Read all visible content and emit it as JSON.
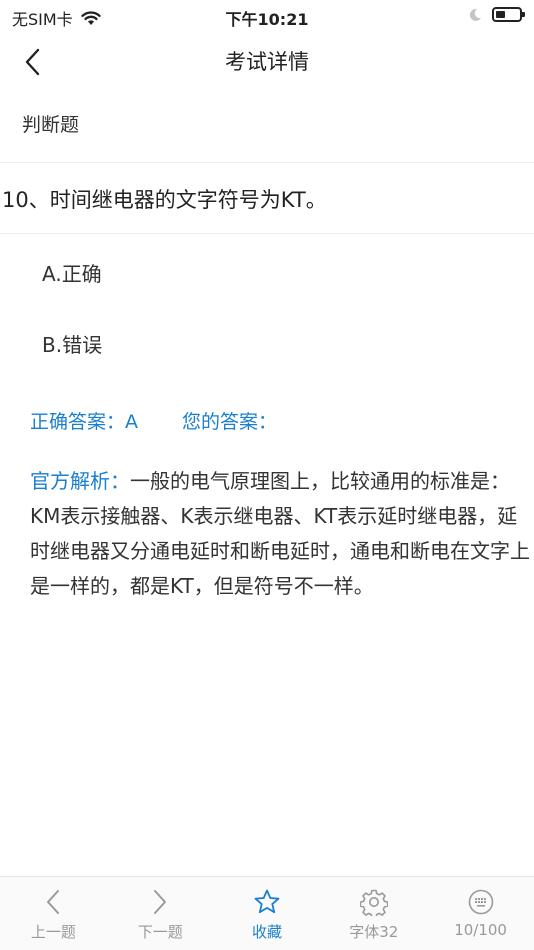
{
  "status_bar": {
    "carrier": "无SIM卡",
    "time": "下午10:21"
  },
  "nav": {
    "title": "考试详情"
  },
  "section": {
    "type_label": "判断题"
  },
  "question": {
    "text": "10、时间继电器的文字符号为KT。"
  },
  "options": [
    {
      "label": "A.正确"
    },
    {
      "label": "B.错误"
    }
  ],
  "answers": {
    "correct": "正确答案：A",
    "yours": "您的答案："
  },
  "analysis": {
    "label": "官方解析：",
    "text": "一般的电气原理图上，比较通用的标准是：KM表示接触器、K表示继电器、KT表示延时继电器，延时继电器又分通电延时和断电延时，通电和断电在文字上是一样的，都是KT，但是符号不一样。"
  },
  "tabs": [
    {
      "label": "上一题",
      "icon": "chevron-left-icon"
    },
    {
      "label": "下一题",
      "icon": "chevron-right-icon"
    },
    {
      "label": "收藏",
      "icon": "star-icon"
    },
    {
      "label": "字体32",
      "icon": "gear-icon"
    },
    {
      "label": "10/100",
      "icon": "keyboard-icon"
    }
  ],
  "colors": {
    "accent": "#1a7fd0",
    "muted": "#999999"
  }
}
